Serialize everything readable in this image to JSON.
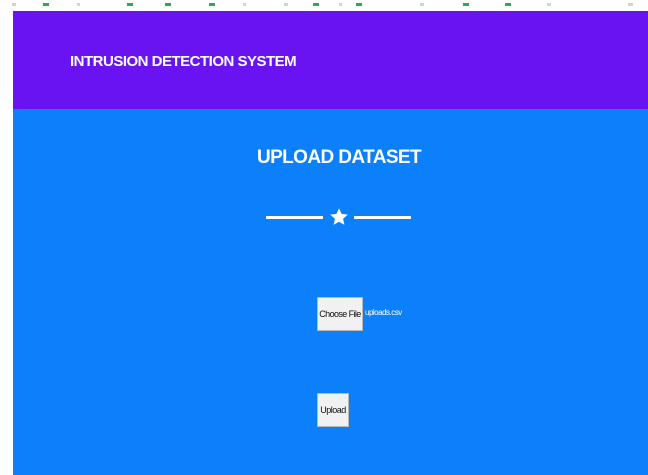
{
  "navbar": {
    "brand": "INTRUSION DETECTION SYSTEM"
  },
  "main": {
    "heading": "UPLOAD DATASET",
    "divider_icon": "star-icon",
    "file_input": {
      "button_label": "Choose File",
      "selected_file": "uploads.csv"
    },
    "upload_button_label": "Upload"
  },
  "colors": {
    "navbar_bg": "#6a13f2",
    "main_bg": "#0c7ffa",
    "text": "#ffffff"
  }
}
